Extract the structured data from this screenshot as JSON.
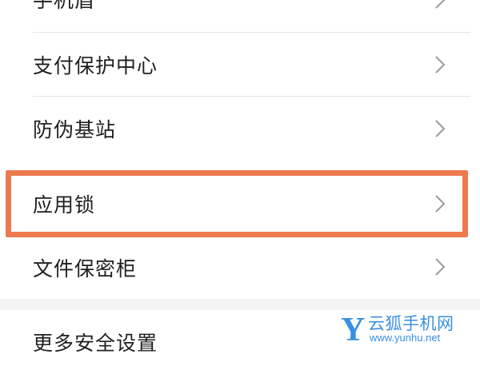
{
  "settings_list": {
    "items": [
      {
        "label": "手机盾"
      },
      {
        "label": "支付保护中心"
      },
      {
        "label": "防伪基站"
      },
      {
        "label": "应用锁"
      },
      {
        "label": "文件保密柜"
      },
      {
        "label": "更多安全设置"
      }
    ],
    "chevron_icon": "chevron-right-icon"
  },
  "highlight": {
    "target": "应用锁",
    "color": "#ec7a4d"
  },
  "watermark": {
    "logo_letter": "Y",
    "title": "云狐手机网",
    "url": "www.yunhu.net",
    "color": "#3a8fe0"
  }
}
